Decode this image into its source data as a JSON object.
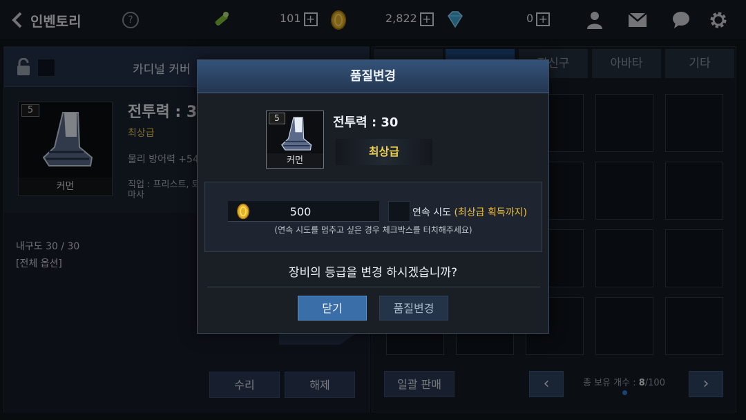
{
  "topbar": {
    "title": "인벤토리",
    "help": "?",
    "resource1_value": "101",
    "resource2_value": "2,822",
    "resource3_value": "0",
    "plus": "+"
  },
  "left_panel": {
    "title": "카디널 커버",
    "item_level": "5",
    "item_name": "커먼",
    "power": "전투력 : 3",
    "grade": "최상급",
    "stat": "물리 방어력 +54",
    "job": "직업 : 프리스트, 퇴마사",
    "durability": "내구도 30 / 30",
    "all_options": "[전체 옵션]",
    "repair_button": "수리",
    "release_button": "해제"
  },
  "right_panel": {
    "tabs": [
      "",
      "",
      "장신구",
      "아바타",
      "기타"
    ],
    "bulk_sell_button": "일괄 판매",
    "count_label": "총 보유 개수 : ",
    "count_current": "8",
    "count_max": "/100"
  },
  "modal": {
    "title": "품질변경",
    "item_level": "5",
    "item_name": "커먼",
    "power": "전투력 : 30",
    "grade": "최상급",
    "cost": "500",
    "repeat_label": "연속 시도",
    "repeat_note": "(최상급 획득까지)",
    "hint": "(연속 시도를 멈추고 싶은 경우 체크박스를 터치해주세요)",
    "question": "장비의 등급을 변경 하시겠습니까?",
    "close_button": "닫기",
    "change_button": "품질변경"
  },
  "colors": {
    "accent_blue": "#1f4d86",
    "grade_gold": "#ecd04a",
    "button_blue": "#3a6ea8"
  },
  "icons": [
    "back-chevron-icon",
    "help-icon",
    "light-stick-icon",
    "gold-coin-icon",
    "diamond-icon",
    "friends-icon",
    "mail-icon",
    "chat-icon",
    "settings-gear-icon",
    "lock-icon",
    "boot-item-icon",
    "prev-page-icon",
    "next-page-icon"
  ]
}
